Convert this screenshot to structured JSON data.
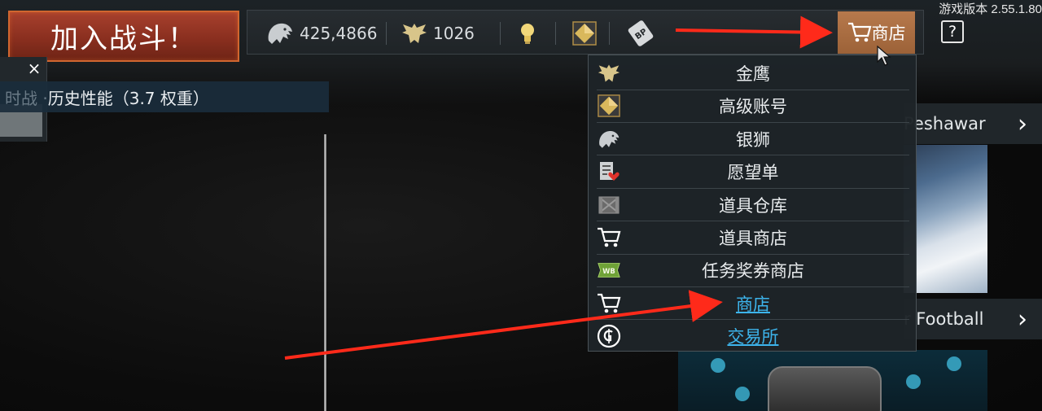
{
  "join_button": {
    "label": "加入战斗！"
  },
  "side_panel": {
    "close_glyph": "×",
    "history_label": "历史性能（3.7 权重）",
    "clip_text": "时战 ·"
  },
  "topbar": {
    "silver_lions": "425,4866",
    "golden_eagles": "1026",
    "shop_label": "商店",
    "help_label": "?",
    "icons": [
      "lion-icon",
      "eagle-icon",
      "lightbulb-icon",
      "premium-diamond-icon",
      "battle-pass-icon",
      "cart-icon",
      "help-icon"
    ]
  },
  "version": "游戏版本 2.55.1.80",
  "dropdown": {
    "items": [
      {
        "label": "金鹰",
        "icon": "eagle-icon",
        "link": false
      },
      {
        "label": "高级账号",
        "icon": "premium-diamond-icon",
        "link": false
      },
      {
        "label": "银狮",
        "icon": "lion-icon",
        "link": false
      },
      {
        "label": "愿望单",
        "icon": "wishlist-icon",
        "link": false
      },
      {
        "label": "道具仓库",
        "icon": "crate-icon",
        "link": false
      },
      {
        "label": "道具商店",
        "icon": "cart-icon",
        "link": false
      },
      {
        "label": "任务奖券商店",
        "icon": "warbond-icon",
        "link": false
      },
      {
        "label": "商店",
        "icon": "cart-icon",
        "link": true
      },
      {
        "label": "交易所",
        "icon": "marketplace-icon",
        "link": true
      }
    ]
  },
  "news": {
    "item1_title": "Peshawar",
    "item2_title": "r Football"
  },
  "colors": {
    "accent_orange": "#9c6238",
    "link_blue": "#3db4ec",
    "join_red": "#8a2f1f",
    "arrow_red": "#ff2a1a"
  }
}
